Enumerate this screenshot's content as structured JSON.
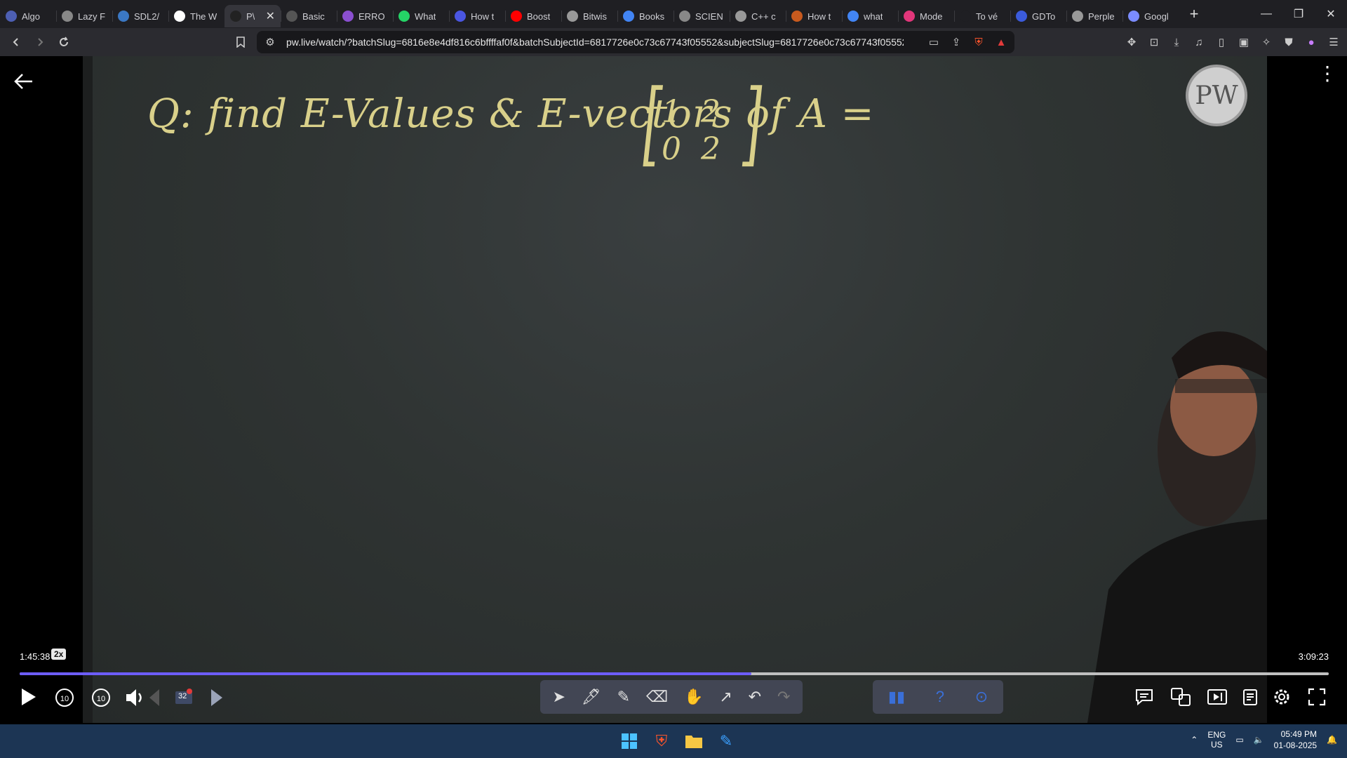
{
  "browser": {
    "tabs": [
      {
        "label": "Algo",
        "favicon_color": "#4d5fb3"
      },
      {
        "label": "Lazy F",
        "favicon_color": "#888888"
      },
      {
        "label": "SDL2/",
        "favicon_color": "#3b78c4"
      },
      {
        "label": "The W",
        "favicon_color": "#ffffff"
      },
      {
        "label": "P\\",
        "favicon_color": "#222222",
        "active": true
      },
      {
        "label": "Basic",
        "favicon_color": "#555555"
      },
      {
        "label": "ERRO",
        "favicon_color": "#8a4fd0"
      },
      {
        "label": "What",
        "favicon_color": "#25d366"
      },
      {
        "label": "How t",
        "favicon_color": "#4a56e2"
      },
      {
        "label": "Boost",
        "favicon_color": "#ff0000"
      },
      {
        "label": "Bitwis",
        "favicon_color": "#999999"
      },
      {
        "label": "Books",
        "favicon_color": "#4285f4"
      },
      {
        "label": "SCIEN",
        "favicon_color": "#888888"
      },
      {
        "label": "C++ c",
        "favicon_color": "#999999"
      },
      {
        "label": "How t",
        "favicon_color": "#c85a1e"
      },
      {
        "label": "what",
        "favicon_color": "#4285f4"
      },
      {
        "label": "Mode",
        "favicon_color": "#e2367a"
      },
      {
        "label": "To vé",
        "favicon_color": "#1f1f23"
      },
      {
        "label": "GDTo",
        "favicon_color": "#3b5bdb"
      },
      {
        "label": "Perple",
        "favicon_color": "#999999"
      },
      {
        "label": "Googl",
        "favicon_color": "#7b8cff"
      }
    ],
    "active_tab_close": "✕",
    "new_tab": "+",
    "url": "pw.live/watch/?batchSlug=6816e8e4df816c6bffffaf0f&batchSubjectId=6817726e0c73c67743f05552&subjectSlug=6817726e0c73c67743f05552...",
    "window_controls": {
      "minimize": "—",
      "restore": "❐",
      "close": "✕"
    }
  },
  "lecture": {
    "question_text": "Q: find E-Values & E-vectors of A =",
    "matrix": [
      "1",
      "2",
      "0",
      "2"
    ],
    "logo_text": "PW"
  },
  "player": {
    "current_time": "1:45:38",
    "speed": "2x",
    "total_time": "3:09:23",
    "progress": 0.559,
    "slide_count": "32",
    "accent_color": "#6d5dfb"
  },
  "taskbar": {
    "lang_top": "ENG",
    "lang_bottom": "US",
    "time": "05:49 PM",
    "date": "01-08-2025"
  }
}
